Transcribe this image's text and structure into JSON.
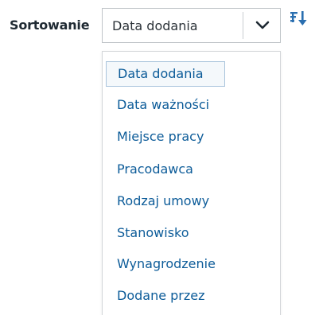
{
  "sort": {
    "label": "Sortowanie",
    "selected_value": "Data dodania",
    "arrow_icon": "chevron-down-icon",
    "direction_icon": "sort-descending-icon"
  },
  "dropdown": {
    "options": [
      {
        "label": "Data dodania",
        "selected": true
      },
      {
        "label": "Data ważności",
        "selected": false
      },
      {
        "label": "Miejsce pracy",
        "selected": false
      },
      {
        "label": "Pracodawca",
        "selected": false
      },
      {
        "label": "Rodzaj umowy",
        "selected": false
      },
      {
        "label": "Stanowisko",
        "selected": false
      },
      {
        "label": "Wynagrodzenie",
        "selected": false
      },
      {
        "label": "Dodane przez",
        "selected": false
      }
    ]
  },
  "colors": {
    "option_text": "#0d5c99",
    "label_text": "#1f2a33",
    "icon": "#2a6fb0"
  }
}
